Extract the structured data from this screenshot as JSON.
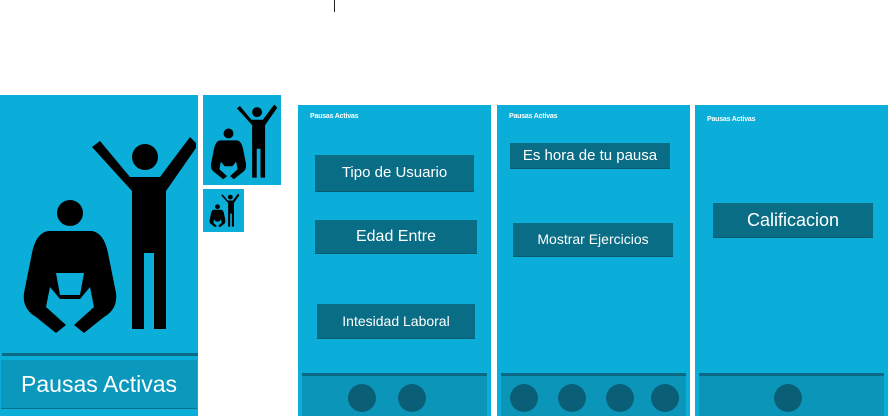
{
  "splash": {
    "title": "Pausas Activas"
  },
  "screens": [
    {
      "app_title": "Pausas Activas",
      "buttons": [
        "Tipo de Usuario",
        "Edad Entre",
        "Intesidad Laboral"
      ],
      "nav_count": 2
    },
    {
      "app_title": "Pausas Activas",
      "buttons": [
        "Es hora de tu pausa",
        "Mostrar Ejercicios"
      ],
      "nav_count": 4
    },
    {
      "app_title": "Pausas Activas",
      "buttons": [
        "Calificacion"
      ],
      "nav_count": 1
    }
  ],
  "colors": {
    "primary": "#0aaed8",
    "button": "#0a6d86",
    "nav_bar": "#0b95b9",
    "nav_dot": "#0a5f77",
    "figure": "#000000"
  },
  "icons": [
    "exercise-figures-icon"
  ]
}
